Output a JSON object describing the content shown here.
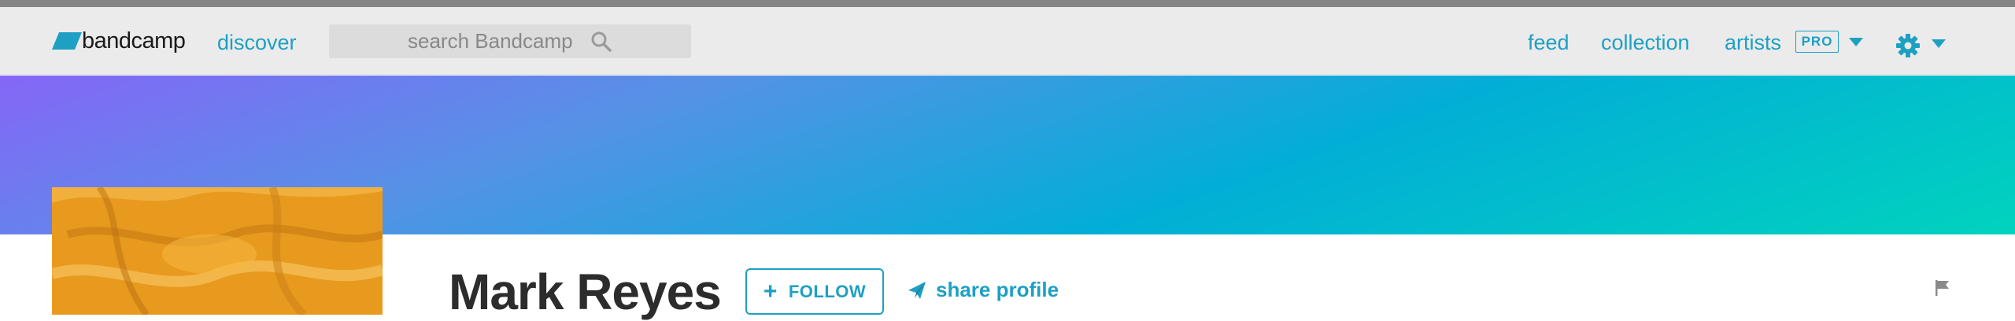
{
  "colors": {
    "accent": "#1da0c3",
    "navbar_bg": "#ebebeb",
    "banner_gradient": [
      "#8566f7",
      "#5592e6",
      "#02aed6",
      "#01d3be"
    ],
    "avatar_bg": "#e79c23",
    "name_text": "#2c2c2c"
  },
  "header": {
    "logo_text": "bandcamp",
    "logo_icon": "bandcamp-parallelogram-icon",
    "discover_label": "discover",
    "search": {
      "placeholder": "search Bandcamp",
      "value": "",
      "icon": "search-icon"
    },
    "nav": {
      "feed": "feed",
      "collection": "collection",
      "artists": "artists",
      "pro_badge": "PRO"
    },
    "settings_icon": "gear-icon"
  },
  "profile": {
    "name": "Mark Reyes",
    "follow_label": "FOLLOW",
    "follow_icon": "plus-icon",
    "share_label": "share profile",
    "share_icon": "paper-plane-icon",
    "flag_icon": "flag-icon"
  }
}
